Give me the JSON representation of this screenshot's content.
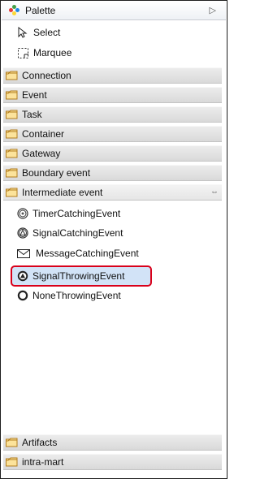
{
  "palette": {
    "title": "Palette",
    "tools": [
      {
        "label": "Select",
        "icon": "pointer-arrow-icon"
      },
      {
        "label": "Marquee",
        "icon": "marquee-icon"
      }
    ],
    "drawers": [
      {
        "label": "Connection"
      },
      {
        "label": "Event"
      },
      {
        "label": "Task"
      },
      {
        "label": "Container"
      },
      {
        "label": "Gateway"
      },
      {
        "label": "Boundary event"
      },
      {
        "label": "Intermediate event",
        "open": true
      }
    ],
    "intermediate_entries": [
      {
        "label": "TimerCatchingEvent",
        "icon": "timer-event-icon"
      },
      {
        "label": "SignalCatchingEvent",
        "icon": "signal-catching-icon"
      },
      {
        "label": "MessageCatchingEvent",
        "icon": "message-envelope-icon"
      },
      {
        "label": "SignalThrowingEvent",
        "icon": "signal-throwing-icon",
        "selected": true
      },
      {
        "label": "NoneThrowingEvent",
        "icon": "none-throwing-icon"
      }
    ],
    "bottom_drawers": [
      {
        "label": "Artifacts"
      },
      {
        "label": "intra-mart"
      }
    ],
    "colors": {
      "highlight": "#d2e3f7",
      "selection_outline": "#d9001a",
      "folder": "#f3c053"
    }
  }
}
